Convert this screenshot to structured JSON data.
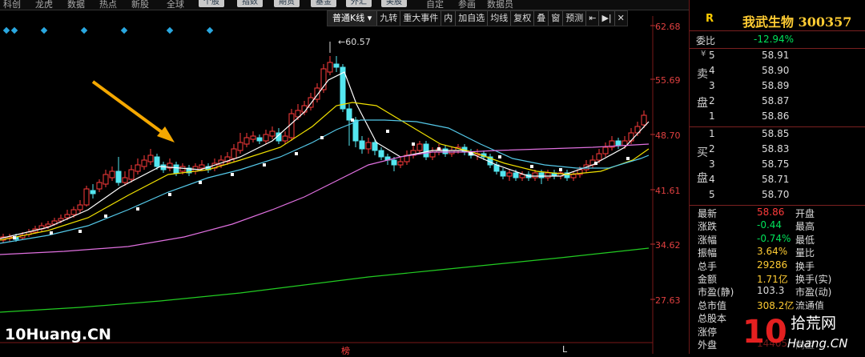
{
  "nav": {
    "items": [
      "科创",
      "龙虎",
      "数据",
      "热点",
      "新股",
      "全球",
      "个股",
      "指数",
      "期货",
      "基金",
      "外汇",
      "美股",
      "自定",
      "参画",
      "数据员"
    ]
  },
  "toolbar": {
    "kline_type": "普通K线",
    "items": [
      "九转",
      "重大事件",
      "内",
      "加自选",
      "均线",
      "复权",
      "叠",
      "窗",
      "预测"
    ]
  },
  "price_axis": [
    "62.68",
    "55.69",
    "48.70",
    "41.61",
    "34.62",
    "27.63"
  ],
  "chart_labels": {
    "peak_value": "60.57",
    "bottom_mark_1": "榜",
    "bottom_mark_2": "L"
  },
  "watermark": "10Huang.CN",
  "panel": {
    "r_label": "R",
    "stock_title": "我武生物 300357",
    "weibi_label": "委比",
    "weibi_value": "-12.94%",
    "sell_label": [
      "卖",
      "盘"
    ],
    "buy_label": [
      "买",
      "盘"
    ],
    "sell_rows": [
      {
        "level": "5",
        "price": "58.91"
      },
      {
        "level": "4",
        "price": "58.90"
      },
      {
        "level": "3",
        "price": "58.89"
      },
      {
        "level": "2",
        "price": "58.87"
      },
      {
        "level": "1",
        "price": "58.86"
      }
    ],
    "buy_rows": [
      {
        "level": "1",
        "price": "58.85"
      },
      {
        "level": "2",
        "price": "58.83"
      },
      {
        "level": "3",
        "price": "58.75"
      },
      {
        "level": "4",
        "price": "58.71"
      },
      {
        "level": "5",
        "price": "58.70"
      }
    ],
    "quote_rows": [
      {
        "label": "最新",
        "value": "58.86",
        "color": "red",
        "label2": "开盘"
      },
      {
        "label": "涨跌",
        "value": "-0.44",
        "color": "green",
        "label2": "最高"
      },
      {
        "label": "涨幅",
        "value": "-0.74%",
        "color": "green",
        "label2": "最低"
      },
      {
        "label": "振幅",
        "value": "3.64%",
        "color": "yellow",
        "label2": "量比"
      },
      {
        "label": "总手",
        "value": "29286",
        "color": "yellow",
        "label2": "换手"
      },
      {
        "label": "金额",
        "value": "1.71亿",
        "color": "yellow",
        "label2": "换手(实)"
      },
      {
        "label": "市盈(静)",
        "value": "103.3",
        "color": "white",
        "label2": "市盈(动)"
      },
      {
        "label": "总市值",
        "value": "308.2亿",
        "color": "yellow",
        "label2": "流通值"
      },
      {
        "label": "总股本",
        "value": "",
        "color": "yellow",
        "label2": ""
      },
      {
        "label": "涨停",
        "value": "",
        "color": "red",
        "label2": ""
      },
      {
        "label": "外盘",
        "value": "14405",
        "color": "red",
        "label2": "内盘"
      }
    ],
    "logo_text": "拾荒网",
    "logo_sub": "Huang.CN",
    "logo_num": "10"
  }
}
